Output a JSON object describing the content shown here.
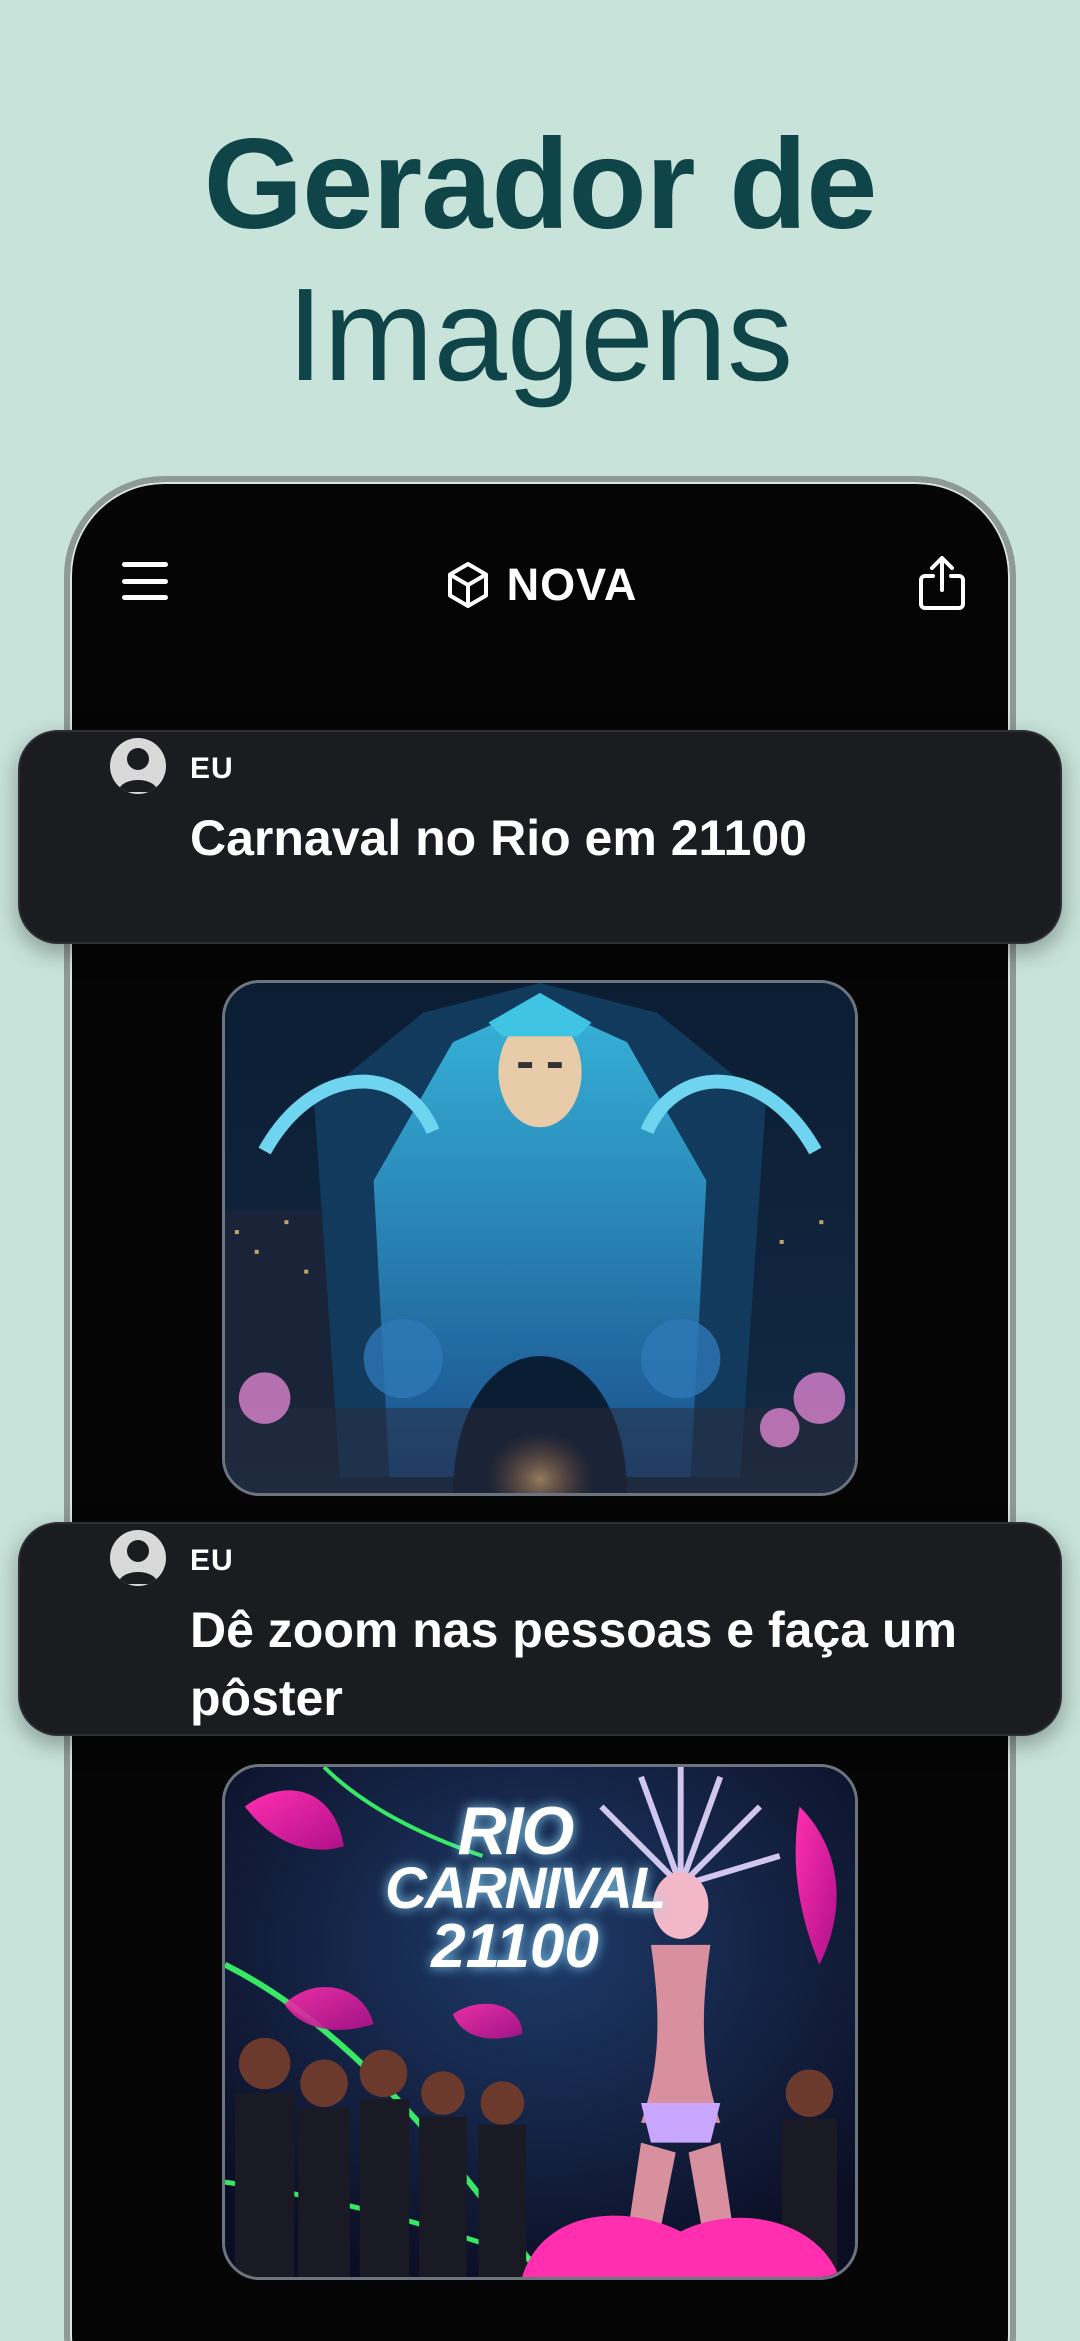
{
  "headline": {
    "line1": "Gerador de",
    "line2": "Imagens"
  },
  "app": {
    "brand_name": "NOVA"
  },
  "chat": [
    {
      "author": "EU",
      "message": "Carnaval no Rio em 21100"
    },
    {
      "author": "EU",
      "message": "Dê zoom nas pessoas e faça um pôster"
    }
  ],
  "poster": {
    "line1": "RIO",
    "line2": "CARNIVAL",
    "line3": "21100"
  },
  "colors": {
    "background": "#c8e4da",
    "headline": "#0f4548",
    "phone": "#050505",
    "bubble": "#1b1c1f"
  },
  "icons": {
    "menu": "hamburger-menu-icon",
    "logo": "nova-logo-icon",
    "share": "share-icon",
    "avatar": "user-avatar-icon"
  }
}
